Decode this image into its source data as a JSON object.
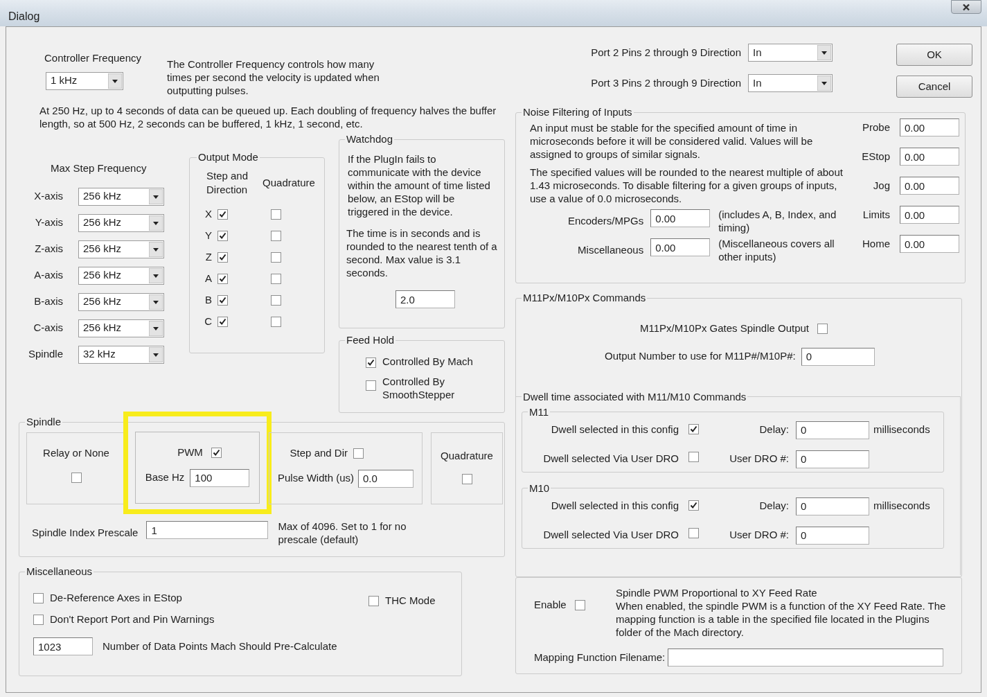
{
  "window": {
    "title": "Dialog"
  },
  "controller_frequency": {
    "label": "Controller Frequency",
    "value": "1 kHz",
    "description": "The Controller Frequency controls how many times per second the velocity is updated when outputting pulses."
  },
  "buffer_note": "At 250 Hz, up to 4 seconds of data can be queued up.  Each doubling of frequency halves the buffer length, so at 500 Hz, 2 seconds can be buffered, 1 kHz, 1 second, etc.",
  "max_step_frequency": {
    "title": "Max Step Frequency",
    "rows": [
      {
        "label": "X-axis",
        "value": "256 kHz"
      },
      {
        "label": "Y-axis",
        "value": "256 kHz"
      },
      {
        "label": "Z-axis",
        "value": "256 kHz"
      },
      {
        "label": "A-axis",
        "value": "256 kHz"
      },
      {
        "label": "B-axis",
        "value": "256 kHz"
      },
      {
        "label": "C-axis",
        "value": "256 kHz"
      },
      {
        "label": "Spindle",
        "value": "32 kHz"
      }
    ]
  },
  "output_mode": {
    "title": "Output Mode",
    "step_dir_heading": "Step and Direction",
    "quadrature_heading": "Quadrature",
    "rows": [
      {
        "axis": "X",
        "step_dir": true,
        "quadrature": false
      },
      {
        "axis": "Y",
        "step_dir": true,
        "quadrature": false
      },
      {
        "axis": "Z",
        "step_dir": true,
        "quadrature": false
      },
      {
        "axis": "A",
        "step_dir": true,
        "quadrature": false
      },
      {
        "axis": "B",
        "step_dir": true,
        "quadrature": false
      },
      {
        "axis": "C",
        "step_dir": true,
        "quadrature": false
      }
    ]
  },
  "watchdog": {
    "title": "Watchdog",
    "text_1": "If the PlugIn fails to communicate with the device within the amount of time listed below, an EStop will be triggered in the device.",
    "text_2": "The time is in seconds and is rounded to the nearest tenth of a second.  Max value is 3.1 seconds.",
    "value": "2.0"
  },
  "feed_hold": {
    "title": "Feed Hold",
    "options": [
      {
        "label": "Controlled By Mach",
        "checked": true
      },
      {
        "label": "Controlled By SmoothStepper",
        "checked": false
      }
    ]
  },
  "spindle": {
    "title": "Spindle",
    "modes": [
      {
        "kind": "relay",
        "label": "Relay or None",
        "checked": false
      },
      {
        "kind": "pwm",
        "label": "PWM",
        "checked": true,
        "field_label": "Base Hz",
        "value": "100",
        "highlighted": true
      },
      {
        "kind": "step_dir",
        "label": "Step and Dir",
        "checked": false,
        "field_label": "Pulse Width (us)",
        "value": "0.0"
      },
      {
        "kind": "quadrature",
        "label": "Quadrature",
        "checked": false
      }
    ],
    "prescale": {
      "label": "Spindle Index Prescale",
      "value": "1",
      "note": "Max of 4096. Set to 1 for no prescale (default)"
    }
  },
  "miscellaneous": {
    "title": "Miscellaneous",
    "options": [
      {
        "label": "De-Reference Axes in EStop",
        "checked": false
      },
      {
        "label": "Don't Report Port and Pin Warnings",
        "checked": false
      },
      {
        "label": "THC Mode",
        "checked": false
      }
    ],
    "data_points": {
      "value": "1023",
      "label": "Number of Data Points Mach Should Pre-Calculate"
    }
  },
  "port_directions": [
    {
      "label": "Port 2 Pins 2 through 9 Direction",
      "value": "In"
    },
    {
      "label": "Port 3 Pins 2 through 9 Direction",
      "value": "In"
    }
  ],
  "buttons": [
    "OK",
    "Cancel"
  ],
  "noise_filtering": {
    "title": "Noise Filtering of Inputs",
    "text_1": "An input must be stable for the specified amount of time in microseconds before it will be considered valid.  Values will be assigned to groups of similar signals.",
    "text_2": "The specified values will be rounded to the nearest multiple of about 1.43 microseconds.  To disable filtering for a given groups of inputs, use a value of 0.0 microseconds.",
    "inputs": [
      {
        "label": "Encoders/MPGs",
        "value": "0.00",
        "note": "(includes A, B, Index, and timing)"
      },
      {
        "label": "Miscellaneous",
        "value": "0.00",
        "note": "(Miscellaneous covers all other inputs)"
      }
    ],
    "signals": [
      {
        "label": "Probe",
        "value": "0.00"
      },
      {
        "label": "EStop",
        "value": "0.00"
      },
      {
        "label": "Jog",
        "value": "0.00"
      },
      {
        "label": "Limits",
        "value": "0.00"
      },
      {
        "label": "Home",
        "value": "0.00"
      }
    ]
  },
  "m_commands": {
    "title": "M11Px/M10Px Commands",
    "gates_label": "M11Px/M10Px Gates Spindle Output",
    "gates_checked": false,
    "output_label": "Output Number to use for M11P#/M10P#:",
    "output_value": "0",
    "dwell_title": "Dwell time associated with M11/M10 Commands",
    "groups": [
      {
        "title": "M11",
        "config_label": "Dwell selected in this config",
        "config_checked": true,
        "delay_label": "Delay:",
        "delay": "0",
        "unit": "milliseconds",
        "dro_label": "Dwell selected Via User DRO",
        "dro_checked": false,
        "dro_number_label": "User DRO #:",
        "dro_number": "0"
      },
      {
        "title": "M10",
        "config_label": "Dwell selected in this config",
        "config_checked": true,
        "delay_label": "Delay:",
        "delay": "0",
        "unit": "milliseconds",
        "dro_label": "Dwell selected Via User DRO",
        "dro_checked": false,
        "dro_number_label": "User DRO #:",
        "dro_number": "0"
      }
    ]
  },
  "pwm_feed": {
    "enable_label": "Enable",
    "enabled": false,
    "title": "Spindle PWM Proportional to XY Feed Rate",
    "description": "When enabled, the spindle PWM is a function of the XY Feed Rate. The mapping function is a table in the specified file located in the Plugins folder of the Mach directory.",
    "filename_label": "Mapping Function Filename:"
  }
}
